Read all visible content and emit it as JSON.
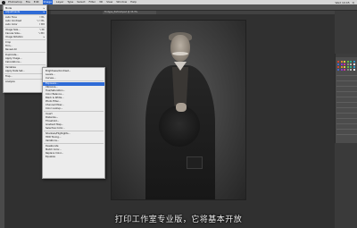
{
  "menubar": {
    "items": [
      "Photoshop",
      "File",
      "Edit",
      "Image",
      "Layer",
      "Type",
      "Select",
      "Filter",
      "3D",
      "View",
      "Window",
      "Help"
    ],
    "active_index": 3,
    "right": [
      "Wed 10:45",
      "Q"
    ]
  },
  "tab": {
    "label": "Tintype_Portrait.psd @ 33.3%"
  },
  "image_menu": {
    "items": [
      {
        "label": "Mode",
        "shortcut": "▸"
      },
      {
        "label": "Adjustments",
        "shortcut": "▸"
      },
      {
        "label": "Auto Tone",
        "shortcut": "⇧⌘L"
      },
      {
        "label": "Auto Contrast",
        "shortcut": "⌥⇧⌘L"
      },
      {
        "label": "Auto Color",
        "shortcut": "⇧⌘B"
      },
      {
        "label": "Image Size...",
        "shortcut": "⌥⌘I"
      },
      {
        "label": "Canvas Size...",
        "shortcut": "⌥⌘C"
      },
      {
        "label": "Image Rotation",
        "shortcut": "▸"
      },
      {
        "label": "Crop",
        "shortcut": ""
      },
      {
        "label": "Trim...",
        "shortcut": ""
      },
      {
        "label": "Reveal All",
        "shortcut": ""
      },
      {
        "label": "Duplicate...",
        "shortcut": ""
      },
      {
        "label": "Apply Image...",
        "shortcut": ""
      },
      {
        "label": "Calculations...",
        "shortcut": ""
      },
      {
        "label": "Variables",
        "shortcut": "▸"
      },
      {
        "label": "Apply Data Set...",
        "shortcut": ""
      },
      {
        "label": "Trap...",
        "shortcut": ""
      },
      {
        "label": "Analysis",
        "shortcut": "▸"
      }
    ]
  },
  "adjustments_menu": {
    "items": [
      "Brightness/Contrast...",
      "Levels...",
      "Curves...",
      "Exposure...",
      "Vibrance...",
      "Hue/Saturation...",
      "Color Balance...",
      "Black & White...",
      "Photo Filter...",
      "Channel Mixer...",
      "Color Lookup...",
      "Invert",
      "Posterize...",
      "Threshold...",
      "Gradient Map...",
      "Selective Color...",
      "Shadows/Highlights...",
      "HDR Toning...",
      "Variations...",
      "Desaturate",
      "Match Color...",
      "Replace Color...",
      "Equalize"
    ],
    "highlight_index": 3
  },
  "subtitle": "打印工作室专业版，它将基本开放",
  "colors": {
    "accent": "#2f6bd6",
    "menu_bg": "#ececec",
    "canvas_bg": "#303030"
  }
}
